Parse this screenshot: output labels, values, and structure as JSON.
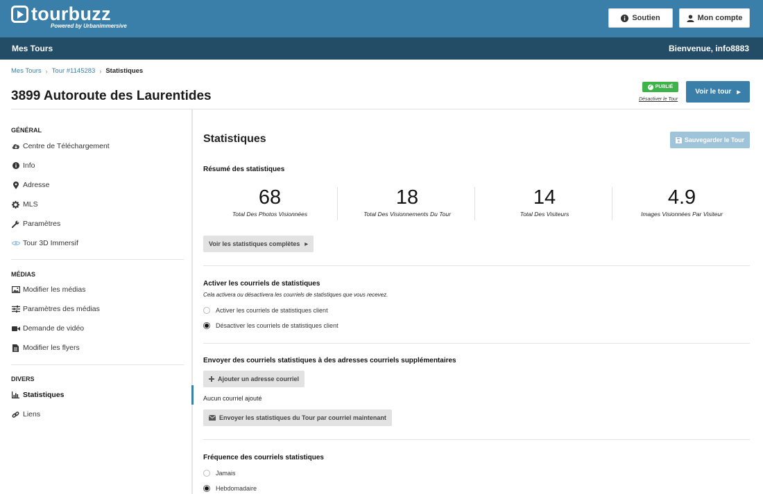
{
  "header": {
    "logo_name": "tourbuzz",
    "logo_sub": "Powered by Urbanimmersive",
    "support_label": "Soutien",
    "account_label": "Mon compte"
  },
  "navbar": {
    "left": "Mes Tours",
    "right": "Bienvenue, info8883"
  },
  "breadcrumb": {
    "items": [
      "Mes Tours",
      "Tour #1145283"
    ],
    "current": "Statistiques"
  },
  "page": {
    "title": "3899 Autoroute des Laurentides",
    "status_badge": "PUBLIÉ",
    "deactivate_link": "Désactiver le Tour",
    "view_tour_label": "Voir le tour"
  },
  "sidebar": {
    "sections": [
      {
        "title": "GÉNÉRAL",
        "items": [
          {
            "label": "Centre de Téléchargement",
            "icon": "cloud-download-icon"
          },
          {
            "label": "Info",
            "icon": "info-icon"
          },
          {
            "label": "Adresse",
            "icon": "map-marker-icon"
          },
          {
            "label": "MLS",
            "icon": "gear-icon"
          },
          {
            "label": "Paramètres",
            "icon": "wrench-icon"
          },
          {
            "label": "Tour 3D Immersif",
            "icon": "3d-icon"
          }
        ]
      },
      {
        "title": "MÉDIAS",
        "items": [
          {
            "label": "Modifier les médias",
            "icon": "image-icon"
          },
          {
            "label": "Paramètres des médias",
            "icon": "sliders-icon"
          },
          {
            "label": "Demande de vidéo",
            "icon": "video-icon"
          },
          {
            "label": "Modifier les flyers",
            "icon": "file-icon"
          }
        ]
      },
      {
        "title": "DIVERS",
        "items": [
          {
            "label": "Statistiques",
            "icon": "bar-chart-icon",
            "active": true
          },
          {
            "label": "Liens",
            "icon": "link-icon"
          }
        ]
      }
    ]
  },
  "main": {
    "title": "Statistiques",
    "save_label": "Sauvegarder le Tour",
    "summary_title": "Résumé des statistiques",
    "stats": [
      {
        "value": "68",
        "label": "Total Des Photos Visionnées"
      },
      {
        "value": "18",
        "label": "Total Des Visionnements Du Tour"
      },
      {
        "value": "14",
        "label": "Total Des Visiteurs"
      },
      {
        "value": "4.9",
        "label": "Images Visionnées Par Visiteur"
      }
    ],
    "full_stats_label": "Voir les statistiques complètes",
    "emails_section": {
      "title": "Activer les courriels de statistiques",
      "description": "Cela activera ou désactivera les courriels de statistiques que vous recevez.",
      "options": [
        "Activer les courriels de statistiques client",
        "Désactiver les courriels de statistiques client"
      ],
      "selected": 1
    },
    "extra_emails": {
      "title": "Envoyer des courriels statistiques à des adresses courriels supplémentaires",
      "add_label": "Ajouter un adresse courriel",
      "empty_text": "Aucun courriel ajouté",
      "send_now_label": "Envoyer les statistiques du Tour par courriel maintenant"
    },
    "frequency": {
      "title": "Fréquence des courriels statistiques",
      "options": [
        "Jamais",
        "Hebdomadaire"
      ],
      "selected": 1
    }
  },
  "colors": {
    "brand": "#3a7fa9",
    "navbar": "#234c67",
    "published": "#3db34a"
  }
}
